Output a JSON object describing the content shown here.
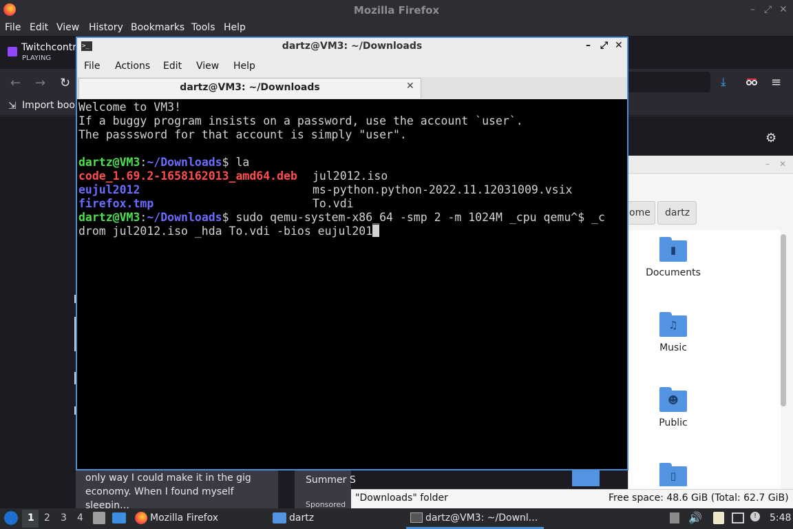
{
  "firefox": {
    "window_title": "Mozilla Firefox",
    "menu": [
      "File",
      "Edit",
      "View",
      "History",
      "Bookmarks",
      "Tools",
      "Help"
    ],
    "tab": {
      "title": "Twitchcontro",
      "status": "PLAYING"
    },
    "bookmarks_import_label": "Import book",
    "window_buttons": [
      "–",
      "⤢",
      "✕"
    ]
  },
  "page": {
    "article_text": "only way I could make it in the gig economy. When I found myself sleepin…",
    "ad_title": "Summer S",
    "ad_sponsored": "Sponsored"
  },
  "file_manager": {
    "breadcrumbs": [
      "ome",
      "dartz"
    ],
    "folders": [
      {
        "name": "Documents",
        "icon": "document-icon"
      },
      {
        "name": "Music",
        "icon": "music-note-icon"
      },
      {
        "name": "Public",
        "icon": "person-icon"
      }
    ],
    "status_left": "\"Downloads\" folder",
    "status_right": "Free space: 48.6 GiB (Total: 62.7 GiB)"
  },
  "terminal": {
    "window_title": "dartz@VM3: ~/Downloads",
    "menu": [
      "File",
      "Actions",
      "Edit",
      "View",
      "Help"
    ],
    "tab_title": "dartz@VM3: ~/Downloads",
    "welcome": [
      "Welcome to VM3!",
      "If a buggy program insists on a password, use the account `user`.",
      "The passsword for that account is simply \"user\"."
    ],
    "prompt_user": "dartz@VM3",
    "prompt_sep": ":",
    "prompt_path": "~/Downloads",
    "prompt_dollar": "$",
    "cmd1": " la",
    "ls": {
      "c1": [
        "code_1.69.2-1658162013_amd64.deb",
        "eujul2012",
        "firefox.tmp"
      ],
      "c2": [
        "jul2012.iso",
        "ms-python.python-2022.11.12031009.vsix",
        "To.vdi"
      ]
    },
    "cmd2_line1": " sudo qemu-system-x86_64 -smp 2 -m 1024M _cpu qemu^$ _c",
    "cmd2_line2": "drom jul2012.iso _hda To.vdi -bios eujul201"
  },
  "taskbar": {
    "workspaces": [
      "1",
      "2",
      "3",
      "4"
    ],
    "tasks": [
      "Mozilla Firefox",
      "dartz",
      "dartz@VM3: ~/Downl..."
    ],
    "clock": "5:48"
  }
}
